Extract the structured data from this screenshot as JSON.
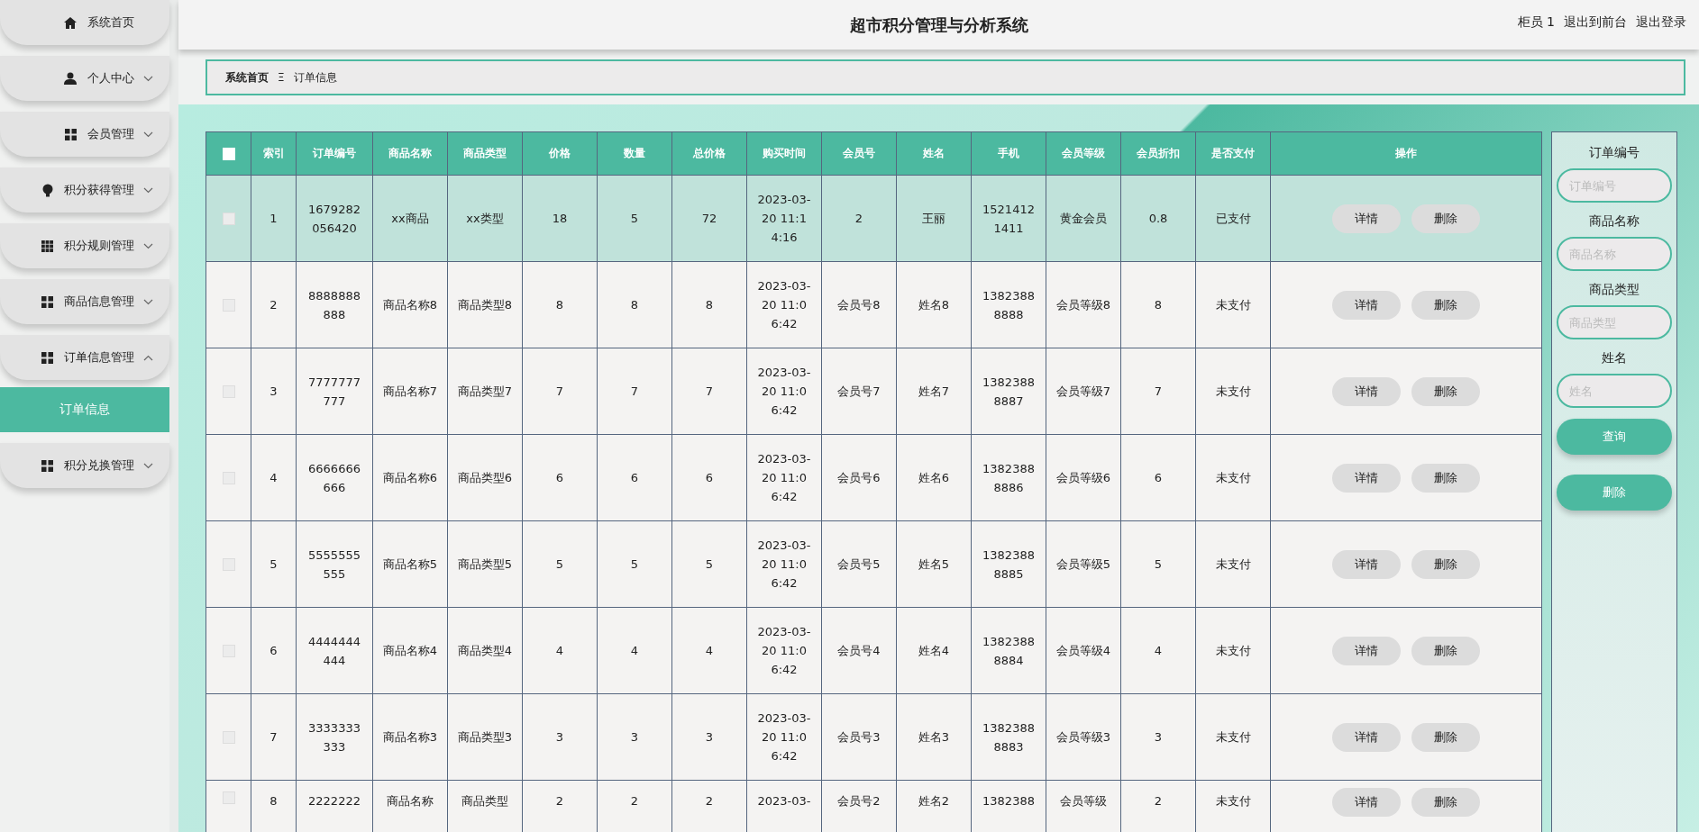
{
  "sidebar": {
    "items": [
      {
        "label": "系统首页"
      },
      {
        "label": "个人中心",
        "expanded": false
      },
      {
        "label": "会员管理",
        "expanded": false
      },
      {
        "label": "积分获得管理",
        "expanded": false
      },
      {
        "label": "积分规则管理",
        "expanded": false
      },
      {
        "label": "商品信息管理",
        "expanded": false
      },
      {
        "label": "订单信息管理",
        "expanded": true,
        "children": [
          {
            "label": "订单信息",
            "selected": true
          }
        ]
      },
      {
        "label": "积分兑换管理",
        "expanded": false
      }
    ]
  },
  "header": {
    "title": "超市积分管理与分析系统",
    "user": "柜员 1",
    "links": [
      "退出到前台",
      "退出登录"
    ]
  },
  "breadcrumb": {
    "home": "系统首页",
    "separator": "Ξ",
    "current": "订单信息"
  },
  "table": {
    "all_checked": false,
    "columns": [
      "索引",
      "订单编号",
      "商品名称",
      "商品类型",
      "价格",
      "数量",
      "总价格",
      "购买时间",
      "会员号",
      "姓名",
      "手机",
      "会员等级",
      "会员折扣",
      "是否支付",
      "操作"
    ],
    "rows": [
      {
        "selected": true,
        "checked": false,
        "cells": [
          "1",
          "1679282056420",
          "xx商品",
          "xx类型",
          "18",
          "5",
          "72",
          "2023-03-20 11:14:16",
          "2",
          "王丽",
          "15214121411",
          "黄金会员",
          "0.8",
          "已支付"
        ],
        "actions": [
          "详情",
          "删除"
        ]
      },
      {
        "selected": false,
        "checked": false,
        "cells": [
          "2",
          "8888888888",
          "商品名称8",
          "商品类型8",
          "8",
          "8",
          "8",
          "2023-03-20 11:06:42",
          "会员号8",
          "姓名8",
          "13823888888",
          "会员等级8",
          "8",
          "未支付"
        ],
        "actions": [
          "详情",
          "删除"
        ]
      },
      {
        "selected": false,
        "checked": false,
        "cells": [
          "3",
          "7777777777",
          "商品名称7",
          "商品类型7",
          "7",
          "7",
          "7",
          "2023-03-20 11:06:42",
          "会员号7",
          "姓名7",
          "13823888887",
          "会员等级7",
          "7",
          "未支付"
        ],
        "actions": [
          "详情",
          "删除"
        ]
      },
      {
        "selected": false,
        "checked": false,
        "cells": [
          "4",
          "6666666666",
          "商品名称6",
          "商品类型6",
          "6",
          "6",
          "6",
          "2023-03-20 11:06:42",
          "会员号6",
          "姓名6",
          "13823888886",
          "会员等级6",
          "6",
          "未支付"
        ],
        "actions": [
          "详情",
          "删除"
        ]
      },
      {
        "selected": false,
        "checked": false,
        "cells": [
          "5",
          "5555555555",
          "商品名称5",
          "商品类型5",
          "5",
          "5",
          "5",
          "2023-03-20 11:06:42",
          "会员号5",
          "姓名5",
          "13823888885",
          "会员等级5",
          "5",
          "未支付"
        ],
        "actions": [
          "详情",
          "删除"
        ]
      },
      {
        "selected": false,
        "checked": false,
        "cells": [
          "6",
          "4444444444",
          "商品名称4",
          "商品类型4",
          "4",
          "4",
          "4",
          "2023-03-20 11:06:42",
          "会员号4",
          "姓名4",
          "13823888884",
          "会员等级4",
          "4",
          "未支付"
        ],
        "actions": [
          "详情",
          "删除"
        ]
      },
      {
        "selected": false,
        "checked": false,
        "cells": [
          "7",
          "3333333333",
          "商品名称3",
          "商品类型3",
          "3",
          "3",
          "3",
          "2023-03-20 11:06:42",
          "会员号3",
          "姓名3",
          "13823888883",
          "会员等级3",
          "3",
          "未支付"
        ],
        "actions": [
          "详情",
          "删除"
        ]
      },
      {
        "selected": false,
        "checked": false,
        "cells": [
          "8",
          "2222222",
          "商品名称",
          "商品类型",
          "2",
          "2",
          "2",
          "2023-03-",
          "会员号2",
          "姓名2",
          "1382388",
          "会员等级",
          "2",
          "未支付"
        ],
        "actions": [
          "详情",
          "删除"
        ]
      }
    ]
  },
  "filters": {
    "fields": [
      {
        "label": "订单编号",
        "placeholder": "订单编号"
      },
      {
        "label": "商品名称",
        "placeholder": "商品名称"
      },
      {
        "label": "商品类型",
        "placeholder": "商品类型"
      },
      {
        "label": "姓名",
        "placeholder": "姓名"
      }
    ],
    "buttons": [
      "查询",
      "删除"
    ]
  }
}
